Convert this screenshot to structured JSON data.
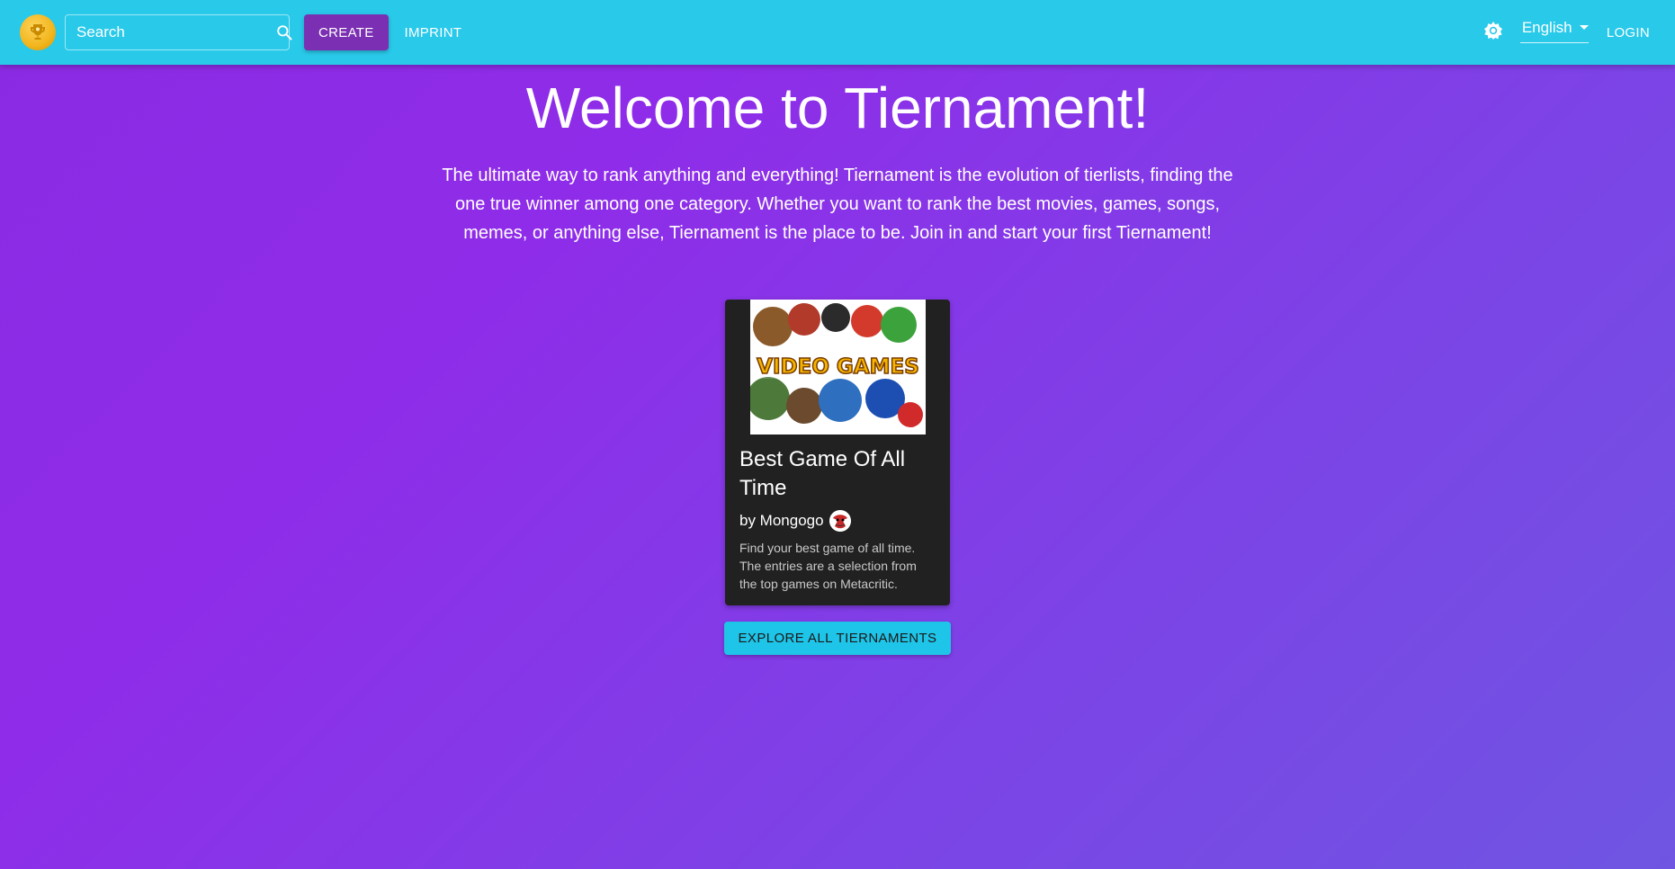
{
  "header": {
    "search_placeholder": "Search",
    "create_label": "CREATE",
    "imprint_label": "IMPRINT",
    "language": "English",
    "login_label": "LOGIN"
  },
  "main": {
    "title": "Welcome to Tiernament!",
    "intro": "The ultimate way to rank anything and everything! Tiernament is the evolution of tierlists, finding the one true winner among one category. Whether you want to rank the best movies, games, songs, memes, or anything else, Tiernament is the place to be. Join in and start your first Tiernament!",
    "featured_card": {
      "image_text": "VIDEO GAMES",
      "title": "Best Game Of All Time",
      "author_prefix": "by Mongogo",
      "description": "Find your best game of all time. The entries are a selection from the top games on Metacritic."
    },
    "explore_label": "EXPLORE ALL TIERNAMENTS"
  },
  "colors": {
    "appbar": "#29c9ea",
    "create_button": "#7b2fb2",
    "background": "#8a2be2",
    "card": "#212121",
    "explore_button": "#1fc5e8"
  },
  "icons": {
    "logo": "trophy-icon",
    "search": "search-icon",
    "theme": "brightness-icon",
    "dropdown": "chevron-down-icon"
  }
}
